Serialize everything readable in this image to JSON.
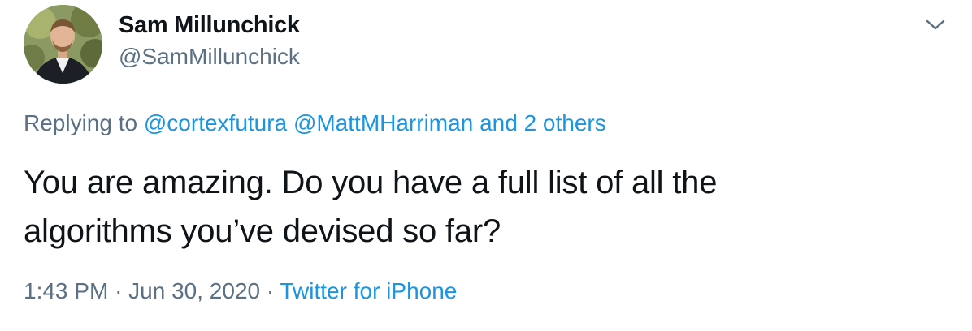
{
  "author": {
    "display_name": "Sam Millunchick",
    "handle": "@SamMillunchick",
    "avatar_icon": "user-avatar-photo"
  },
  "reply": {
    "prefix": "Replying to",
    "mentions": [
      "@cortexfutura",
      "@MattMHarriman"
    ],
    "connector": "and",
    "others": "2 others"
  },
  "tweet": {
    "line1": "You are amazing. Do you have a full list of all the",
    "line2": "algorithms you’ve devised so far?"
  },
  "meta": {
    "time": "1:43 PM",
    "separator": "·",
    "date": "Jun 30, 2020",
    "source": "Twitter for iPhone"
  },
  "menu": {
    "icon": "chevron-down-icon"
  },
  "colors": {
    "link": "#1b95e0",
    "secondary_text": "#5b7083",
    "primary_text": "#0f1419"
  }
}
